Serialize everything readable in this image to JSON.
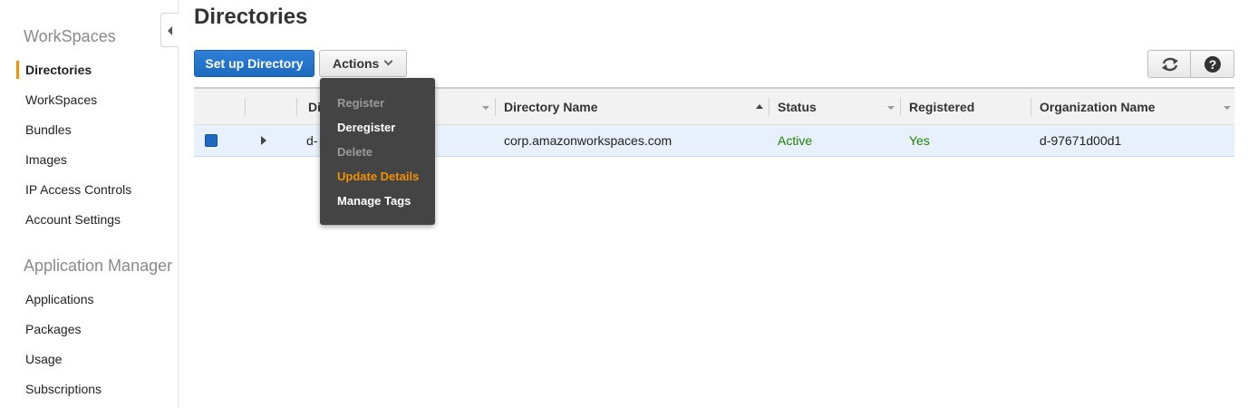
{
  "sidebar": {
    "sections": [
      {
        "title": "WorkSpaces"
      },
      {
        "title": "Application Manager"
      }
    ],
    "items": [
      {
        "label": "Directories",
        "active": true
      },
      {
        "label": "WorkSpaces"
      },
      {
        "label": "Bundles"
      },
      {
        "label": "Images"
      },
      {
        "label": "IP Access Controls"
      },
      {
        "label": "Account Settings"
      },
      {
        "label": "Applications"
      },
      {
        "label": "Packages"
      },
      {
        "label": "Usage"
      },
      {
        "label": "Subscriptions"
      }
    ],
    "collapse_icon": "caret-left-icon"
  },
  "header": {
    "title": "Directories"
  },
  "toolbar": {
    "setup_label": "Set up Directory",
    "actions_label": "Actions",
    "refresh_icon": "refresh-icon",
    "help_icon": "help-icon"
  },
  "actions_menu": {
    "items": [
      {
        "label": "Register",
        "state": "disabled"
      },
      {
        "label": "Deregister",
        "state": "enabled"
      },
      {
        "label": "Delete",
        "state": "disabled"
      },
      {
        "label": "Update Details",
        "state": "hover"
      },
      {
        "label": "Manage Tags",
        "state": "enabled"
      }
    ]
  },
  "table": {
    "columns": [
      "Di",
      "Directory Name",
      "Status",
      "Registered",
      "Organization Name"
    ],
    "rows": [
      {
        "selected": true,
        "directory_id_visible": "d-",
        "directory_name": "corp.amazonworkspaces.com",
        "status": "Active",
        "registered": "Yes",
        "organization_name": "d-97671d00d1"
      }
    ]
  },
  "colors": {
    "accent": "#f29000",
    "primary_button": "#1d6ac0",
    "status_green": "#1d8102",
    "menu_bg": "#444444",
    "row_selected": "#e8f1fb"
  }
}
